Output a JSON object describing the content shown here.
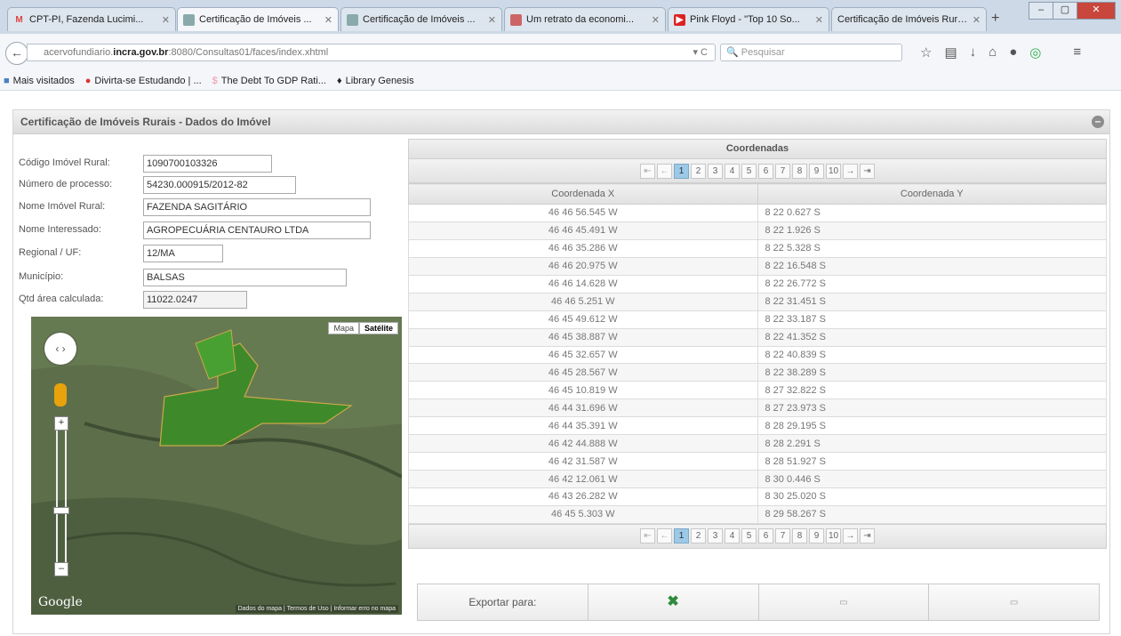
{
  "tabs": [
    {
      "label": "CPT-PI, Fazenda Lucimi...",
      "icon": "gmail-icon",
      "active": false
    },
    {
      "label": "Certificação de Imóveis ...",
      "icon": "page-icon",
      "active": true
    },
    {
      "label": "Certificação de Imóveis ...",
      "icon": "page-icon",
      "active": false
    },
    {
      "label": "Um retrato da economi...",
      "icon": "page-icon",
      "active": false
    },
    {
      "label": "Pink Floyd - \"Top 10 So...",
      "icon": "youtube-icon",
      "active": false
    },
    {
      "label": "Certificação de Imóveis Rurais",
      "icon": "page-icon",
      "active": false
    }
  ],
  "url": {
    "prefix": "acervofundiario.",
    "host": "incra.gov.br",
    "path": ":8080/Consultas01/faces/index.xhtml"
  },
  "search": {
    "placeholder": "Pesquisar"
  },
  "bookmarks": [
    "Mais visitados",
    "Divirta-se Estudando | ...",
    "The Debt To GDP Rati...",
    "Library Genesis"
  ],
  "panel": {
    "title": "Certificação de Imóveis Rurais - Dados do Imóvel"
  },
  "form": {
    "codigo": {
      "label": "Código Imóvel Rural:",
      "value": "1090700103326"
    },
    "processo": {
      "label": "Número de processo:",
      "value": "54230.000915/2012-82"
    },
    "nome": {
      "label": "Nome Imóvel Rural:",
      "value": "FAZENDA SAGITÁRIO"
    },
    "interessado": {
      "label": "Nome Interessado:",
      "value": "AGROPECUÁRIA CENTAURO LTDA"
    },
    "regional": {
      "label": "Regional / UF:",
      "value": "12/MA"
    },
    "municipio": {
      "label": "Município:",
      "value": "BALSAS"
    },
    "area": {
      "label": "Qtd área calculada:",
      "value": "11022.0247"
    }
  },
  "map": {
    "types": [
      "Mapa",
      "Satélite"
    ],
    "logo": "Google",
    "copyright": "Dados do mapa | Termos de Uso | Informar erro no mapa"
  },
  "table": {
    "title": "Coordenadas",
    "pages": [
      "1",
      "2",
      "3",
      "4",
      "5",
      "6",
      "7",
      "8",
      "9",
      "10"
    ],
    "columns": [
      "Coordenada X",
      "Coordenada Y"
    ],
    "rows": [
      [
        "46 46 56.545 W",
        "8 22 0.627 S"
      ],
      [
        "46 46 45.491 W",
        "8 22 1.926 S"
      ],
      [
        "46 46 35.286 W",
        "8 22 5.328 S"
      ],
      [
        "46 46 20.975 W",
        "8 22 16.548 S"
      ],
      [
        "46 46 14.628 W",
        "8 22 26.772 S"
      ],
      [
        "46 46 5.251 W",
        "8 22 31.451 S"
      ],
      [
        "46 45 49.612 W",
        "8 22 33.187 S"
      ],
      [
        "46 45 38.887 W",
        "8 22 41.352 S"
      ],
      [
        "46 45 32.657 W",
        "8 22 40.839 S"
      ],
      [
        "46 45 28.567 W",
        "8 22 38.289 S"
      ],
      [
        "46 45 10.819 W",
        "8 27 32.822 S"
      ],
      [
        "46 44 31.696 W",
        "8 27 23.973 S"
      ],
      [
        "46 44 35.391 W",
        "8 28 29.195 S"
      ],
      [
        "46 42 44.888 W",
        "8 28 2.291 S"
      ],
      [
        "46 42 31.587 W",
        "8 28 51.927 S"
      ],
      [
        "46 42 12.061 W",
        "8 30 0.446 S"
      ],
      [
        "46 43 26.282 W",
        "8 30 25.020 S"
      ],
      [
        "46 45 5.303 W",
        "8 29 58.267 S"
      ]
    ]
  },
  "export": {
    "label": "Exportar para:"
  }
}
